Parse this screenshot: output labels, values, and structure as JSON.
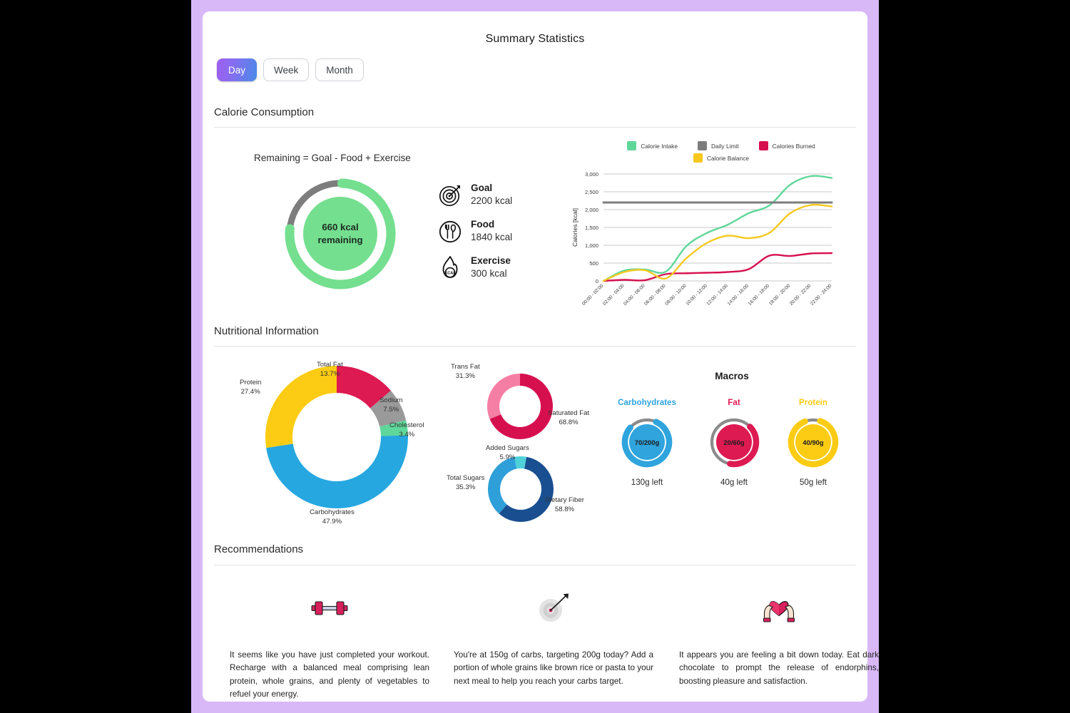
{
  "page": {
    "title": "Summary Statistics",
    "background_color": "#d9b8f7",
    "card_color": "#ffffff"
  },
  "period_tabs": {
    "active": "Day",
    "items": [
      {
        "label": "Day",
        "active": true
      },
      {
        "label": "Week",
        "active": false
      },
      {
        "label": "Month",
        "active": false
      }
    ]
  },
  "sections": {
    "calorie": "Calorie Consumption",
    "nutrition": "Nutritional Information",
    "recommendations": "Recommendations"
  },
  "calorie": {
    "formula": "Remaining =  Goal - Food + Exercise",
    "ring": {
      "value_line1": "660 kcal",
      "value_line2": "remaining",
      "progress_percent": 76,
      "fill_color": "#74df8f",
      "track_color": "#7d7d7d"
    },
    "stats": [
      {
        "icon": "target-icon",
        "label": "Goal",
        "value": "2200 kcal"
      },
      {
        "icon": "cutlery-icon",
        "label": "Food",
        "value": "1840 kcal"
      },
      {
        "icon": "flame-kcal-icon",
        "label": "Exercise",
        "value": "300 kcal"
      }
    ]
  },
  "chart_data": {
    "type": "line",
    "title": "",
    "xlabel": "",
    "ylabel": "Calories [kcal]",
    "ylim": [
      0,
      3000
    ],
    "yticks": [
      0,
      500,
      1000,
      1500,
      2000,
      2500,
      3000
    ],
    "ytick_labels": [
      "0",
      "500",
      "1,000",
      "1,500",
      "2,000",
      "2,500",
      "3,000"
    ],
    "grid": true,
    "legend_position": "top",
    "categories": [
      "00:00 - 02:00",
      "02:00 - 04:00",
      "04:00 - 06:00",
      "06:00 - 08:00",
      "08:00 - 10:00",
      "10:00 - 12:00",
      "12:00 - 14:00",
      "14:00 - 16:00",
      "16:00 - 18:00",
      "18:00 - 20:00",
      "20:00 - 22:00",
      "22:00 - 24:00"
    ],
    "series": [
      {
        "name": "Calorie Intake",
        "color": "#5fd79a",
        "values": [
          0,
          290,
          320,
          260,
          980,
          1350,
          1580,
          1900,
          2120,
          2700,
          2940,
          2890
        ]
      },
      {
        "name": "Daily Limit",
        "color": "#7d7d7d",
        "values": [
          2200,
          2200,
          2200,
          2200,
          2200,
          2200,
          2200,
          2200,
          2200,
          2200,
          2200,
          2200
        ]
      },
      {
        "name": "Calories Burned",
        "color": "#d6104f",
        "values": [
          0,
          30,
          20,
          190,
          215,
          230,
          250,
          330,
          710,
          700,
          770,
          780
        ]
      },
      {
        "name": "Calorie Balance",
        "color": "#f7c81e",
        "values": [
          0,
          250,
          300,
          70,
          640,
          1070,
          1270,
          1200,
          1350,
          1900,
          2130,
          2090
        ]
      }
    ]
  },
  "nutrition": {
    "main_donut": {
      "type": "pie",
      "title": "",
      "labels": [
        "Total Fat",
        "Sodium",
        "Cholesterol",
        "Carbohydrates",
        "Protein"
      ],
      "values": [
        13.7,
        7.5,
        3.4,
        47.9,
        27.4
      ],
      "value_labels": [
        "13.7%",
        "7.5%",
        "3.4%",
        "47.9%",
        "27.4%"
      ],
      "colors": [
        "#de1a52",
        "#9a9a9a",
        "#5fd79a",
        "#26a7e0",
        "#fbcc13"
      ]
    },
    "fat_donut": {
      "type": "pie",
      "labels": [
        "Saturated Fat",
        "Trans Fat"
      ],
      "values": [
        68.8,
        31.3
      ],
      "value_labels": [
        "68.8%",
        "31.3%"
      ],
      "colors": [
        "#d6104f",
        "#f57fa4"
      ]
    },
    "fiber_donut": {
      "type": "pie",
      "labels": [
        "Dietary Fiber",
        "Total Sugars",
        "Added Sugars"
      ],
      "values": [
        58.8,
        35.3,
        5.9
      ],
      "value_labels": [
        "58.8%",
        "35.3%",
        "5.9%"
      ],
      "colors": [
        "#194f90",
        "#2e9fd8",
        "#4fd1d9"
      ]
    },
    "macros": {
      "heading": "Macros",
      "items": [
        {
          "name": "Carbohydrates",
          "value": "70/200g",
          "left": "130g left",
          "color": "#2fa4dd",
          "percent": 35
        },
        {
          "name": "Fat",
          "value": "20/60g",
          "left": "40g left",
          "color": "#de1a52",
          "percent": 33
        },
        {
          "name": "Protein",
          "value": "40/90g",
          "left": "50g left",
          "color": "#fbcc13",
          "percent": 44
        }
      ]
    }
  },
  "recommendations": {
    "items": [
      {
        "icon": "dumbbell-icon",
        "text": "It seems like you have just completed your workout. Recharge with a balanced meal comprising lean protein, whole grains, and plenty of vegetables to refuel your energy."
      },
      {
        "icon": "target-dart-icon",
        "text": "You're at 150g of carbs, targeting 200g today? Add a portion of whole grains like brown rice or pasta to your next meal to help you reach your carbs target."
      },
      {
        "icon": "heart-hands-icon",
        "text": "It appears you are feeling a bit down today. Eat dark chocolate to prompt the release of endorphins, boosting pleasure and satisfaction."
      }
    ]
  }
}
